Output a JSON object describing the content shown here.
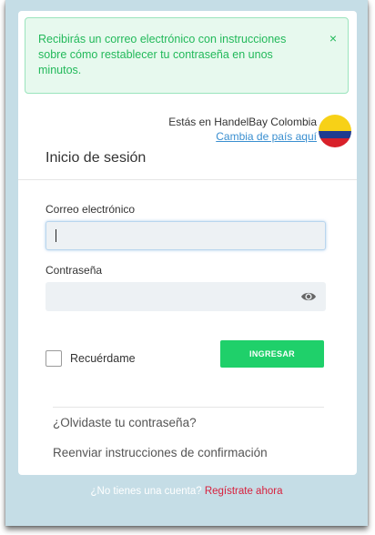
{
  "alert": {
    "message": "Recibirás un correo electrónico con instrucciones sobre cómo restablecer tu contraseña en unos minutos.",
    "close": "×"
  },
  "country": {
    "current": "Estás en HandelBay Colombia",
    "change_link": "Cambia de país aquí",
    "flag_icon": "colombia-flag"
  },
  "login": {
    "title": "Inicio de sesión",
    "email_label": "Correo electrónico",
    "email_value": "",
    "password_label": "Contraseña",
    "password_value": "",
    "remember_label": "Recuérdame",
    "submit_label": "INGRESAR"
  },
  "links": {
    "forgot": "¿Olvidaste tu contraseña?",
    "resend": "Reenviar instrucciones de confirmación"
  },
  "footer": {
    "question": "¿No tienes una cuenta?",
    "register": "Regístrate ahora"
  },
  "colors": {
    "accent_green": "#1fd06a",
    "alert_text": "#22b95a",
    "link_blue": "#3a8fd0",
    "register_red": "#d81f3c",
    "frame_bg": "#c5dde6"
  }
}
